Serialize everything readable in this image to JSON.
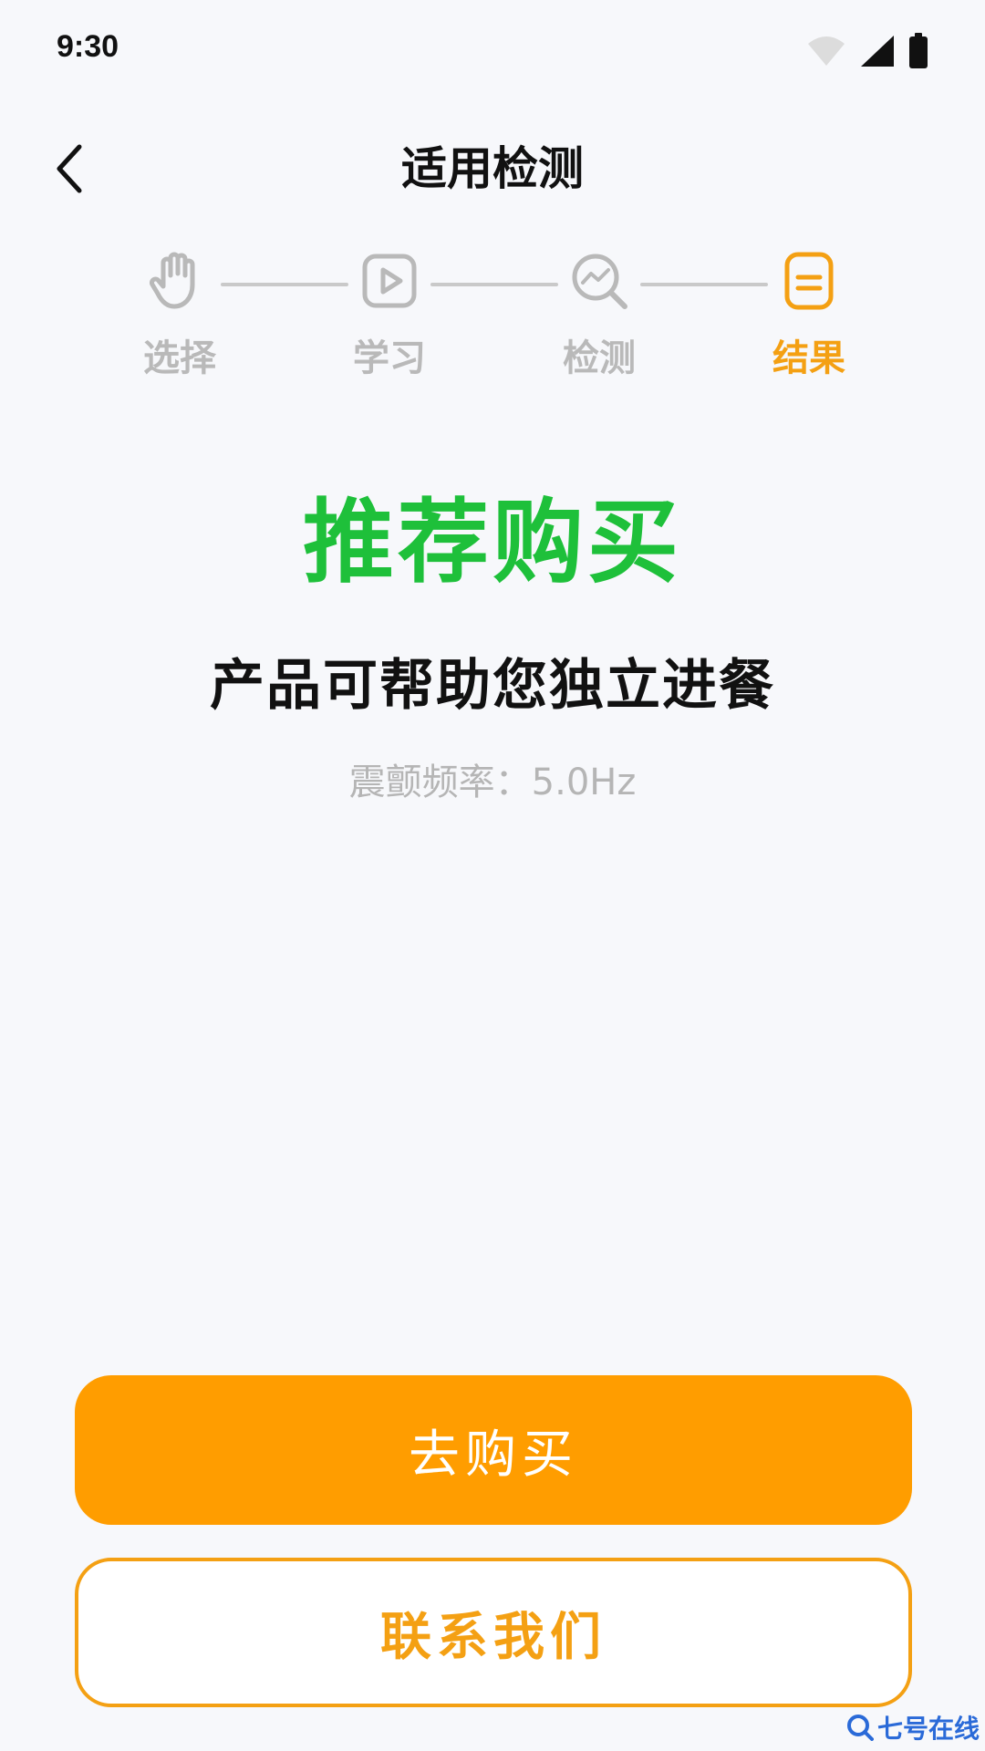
{
  "status_bar": {
    "time": "9:30",
    "icons": [
      "wifi-icon",
      "cellular-signal-icon",
      "battery-icon"
    ]
  },
  "header": {
    "title": "适用检测",
    "back_icon": "chevron-left-icon"
  },
  "stepper": {
    "steps": [
      {
        "label": "选择",
        "icon": "hand-icon",
        "active": false
      },
      {
        "label": "学习",
        "icon": "play-video-icon",
        "active": false
      },
      {
        "label": "检测",
        "icon": "trend-search-icon",
        "active": false
      },
      {
        "label": "结果",
        "icon": "document-icon",
        "active": true
      }
    ],
    "active_color": "#f4a013",
    "inactive_color": "#b9b9b9"
  },
  "result": {
    "title": "推荐购买",
    "description": "产品可帮助您独立进餐",
    "meta": "震颤频率：5.0Hz",
    "title_color": "#1ec03a"
  },
  "actions": {
    "buy_label": "去购买",
    "contact_label": "联系我们",
    "primary_color": "#ff9d00"
  },
  "watermark": {
    "text": "七号在线"
  }
}
